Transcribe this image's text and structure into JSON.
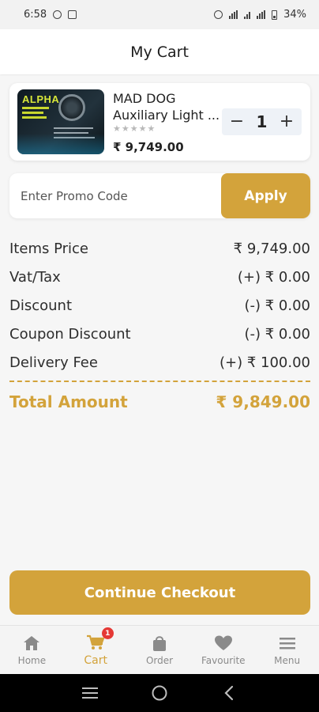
{
  "status_bar": {
    "time": "6:58",
    "battery": "34%"
  },
  "header": {
    "title": "My Cart"
  },
  "cart_item": {
    "thumbnail_brand": "ALPHA",
    "name_line1": "MAD DOG",
    "name_line2": "Auxiliary Light ...",
    "rating": 0,
    "rating_max": 5,
    "price": "₹ 9,749.00",
    "quantity": "1",
    "decrement_symbol": "−",
    "increment_symbol": "+"
  },
  "promo": {
    "placeholder": "Enter Promo Code",
    "apply_label": "Apply"
  },
  "summary": {
    "rows": [
      {
        "label": "Items Price",
        "value": "₹ 9,749.00"
      },
      {
        "label": "Vat/Tax",
        "value": "(+) ₹ 0.00"
      },
      {
        "label": "Discount",
        "value": "(-) ₹ 0.00"
      },
      {
        "label": "Coupon Discount",
        "value": "(-) ₹ 0.00"
      },
      {
        "label": "Delivery Fee",
        "value": "(+) ₹ 100.00"
      }
    ],
    "total_label": "Total Amount",
    "total_value": "₹ 9,849.00"
  },
  "checkout": {
    "label": "Continue Checkout"
  },
  "bottom_nav": {
    "items": [
      {
        "label": "Home",
        "icon": "home-icon"
      },
      {
        "label": "Cart",
        "icon": "cart-icon",
        "badge": "1"
      },
      {
        "label": "Order",
        "icon": "bag-icon"
      },
      {
        "label": "Favourite",
        "icon": "heart-icon"
      },
      {
        "label": "Menu",
        "icon": "menu-icon"
      }
    ],
    "active_index": 1
  },
  "colors": {
    "accent": "#d3a33b",
    "badge": "#e53935",
    "inactive": "#8a8a8a"
  }
}
